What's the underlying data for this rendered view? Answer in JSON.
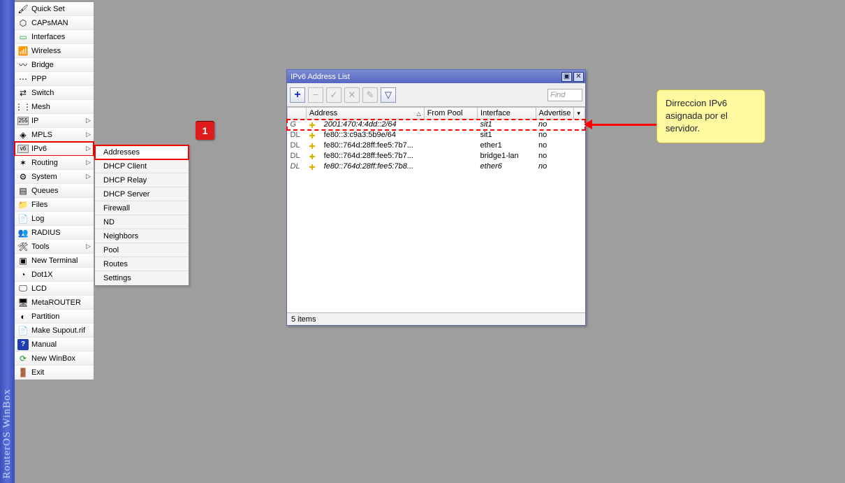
{
  "brand": "RouterOS WinBox",
  "sidebar": {
    "items": [
      {
        "label": "Quick Set",
        "icon": "🖌"
      },
      {
        "label": "CAPsMAN",
        "icon": "⬡"
      },
      {
        "label": "Interfaces",
        "icon": "▭",
        "icon_color": "#2aa13c"
      },
      {
        "label": "Wireless",
        "icon": "📶"
      },
      {
        "label": "Bridge",
        "icon": "〰"
      },
      {
        "label": "PPP",
        "icon": "⋯"
      },
      {
        "label": "Switch",
        "icon": "⇄"
      },
      {
        "label": "Mesh",
        "icon": "⋮⋮"
      },
      {
        "label": "IP",
        "icon": "255",
        "sub": true
      },
      {
        "label": "MPLS",
        "icon": "◈",
        "sub": true
      },
      {
        "label": "IPv6",
        "icon": "v6",
        "sub": true,
        "highlight": true
      },
      {
        "label": "Routing",
        "icon": "✶",
        "sub": true
      },
      {
        "label": "System",
        "icon": "⚙",
        "sub": true
      },
      {
        "label": "Queues",
        "icon": "▤"
      },
      {
        "label": "Files",
        "icon": "📁"
      },
      {
        "label": "Log",
        "icon": "📄"
      },
      {
        "label": "RADIUS",
        "icon": "👥"
      },
      {
        "label": "Tools",
        "icon": "🛠",
        "sub": true
      },
      {
        "label": "New Terminal",
        "icon": "▣"
      },
      {
        "label": "Dot1X",
        "icon": "◔"
      },
      {
        "label": "LCD",
        "icon": "🖵"
      },
      {
        "label": "MetaROUTER",
        "icon": "🖥"
      },
      {
        "label": "Partition",
        "icon": "◐"
      },
      {
        "label": "Make Supout.rif",
        "icon": "📄"
      },
      {
        "label": "Manual",
        "icon": "?",
        "icon_color": "#fff",
        "icon_bg": "#1f3db0"
      },
      {
        "label": "New WinBox",
        "icon": "⟳",
        "icon_color": "#1a8f2d"
      },
      {
        "label": "Exit",
        "icon": "🚪"
      }
    ]
  },
  "submenu": {
    "items": [
      {
        "label": "Addresses",
        "highlight": true
      },
      {
        "label": "DHCP Client"
      },
      {
        "label": "DHCP Relay"
      },
      {
        "label": "DHCP Server"
      },
      {
        "label": "Firewall"
      },
      {
        "label": "ND"
      },
      {
        "label": "Neighbors"
      },
      {
        "label": "Pool"
      },
      {
        "label": "Routes"
      },
      {
        "label": "Settings"
      }
    ]
  },
  "callout1": "1",
  "window": {
    "title": "IPv6 Address List",
    "toolbar": {
      "find_placeholder": "Find"
    },
    "columns": {
      "flag": "",
      "address": "Address",
      "from_pool": "From Pool",
      "interface": "Interface",
      "advertise": "Advertise"
    },
    "rows": [
      {
        "flag": "G",
        "address": "2001:470:4:4dd::2/64",
        "from_pool": "",
        "interface": "sit1",
        "advertise": "no",
        "italic": true,
        "highlight": true
      },
      {
        "flag": "DL",
        "address": "fe80::3:c9a3:5b9e/64",
        "from_pool": "",
        "interface": "sit1",
        "advertise": "no"
      },
      {
        "flag": "DL",
        "address": "fe80::764d:28ff:fee5:7b7...",
        "from_pool": "",
        "interface": "ether1",
        "advertise": "no"
      },
      {
        "flag": "DL",
        "address": "fe80::764d:28ff:fee5:7b7...",
        "from_pool": "",
        "interface": "bridge1-lan",
        "advertise": "no"
      },
      {
        "flag": "DL",
        "address": "fe80::764d:28ff:fee5:7b8...",
        "from_pool": "",
        "interface": "ether6",
        "advertise": "no",
        "italic": true
      }
    ],
    "status": "5 items"
  },
  "note": {
    "line1": "Dirreccion IPv6",
    "line2": "asignada por el",
    "line3": "servidor."
  }
}
